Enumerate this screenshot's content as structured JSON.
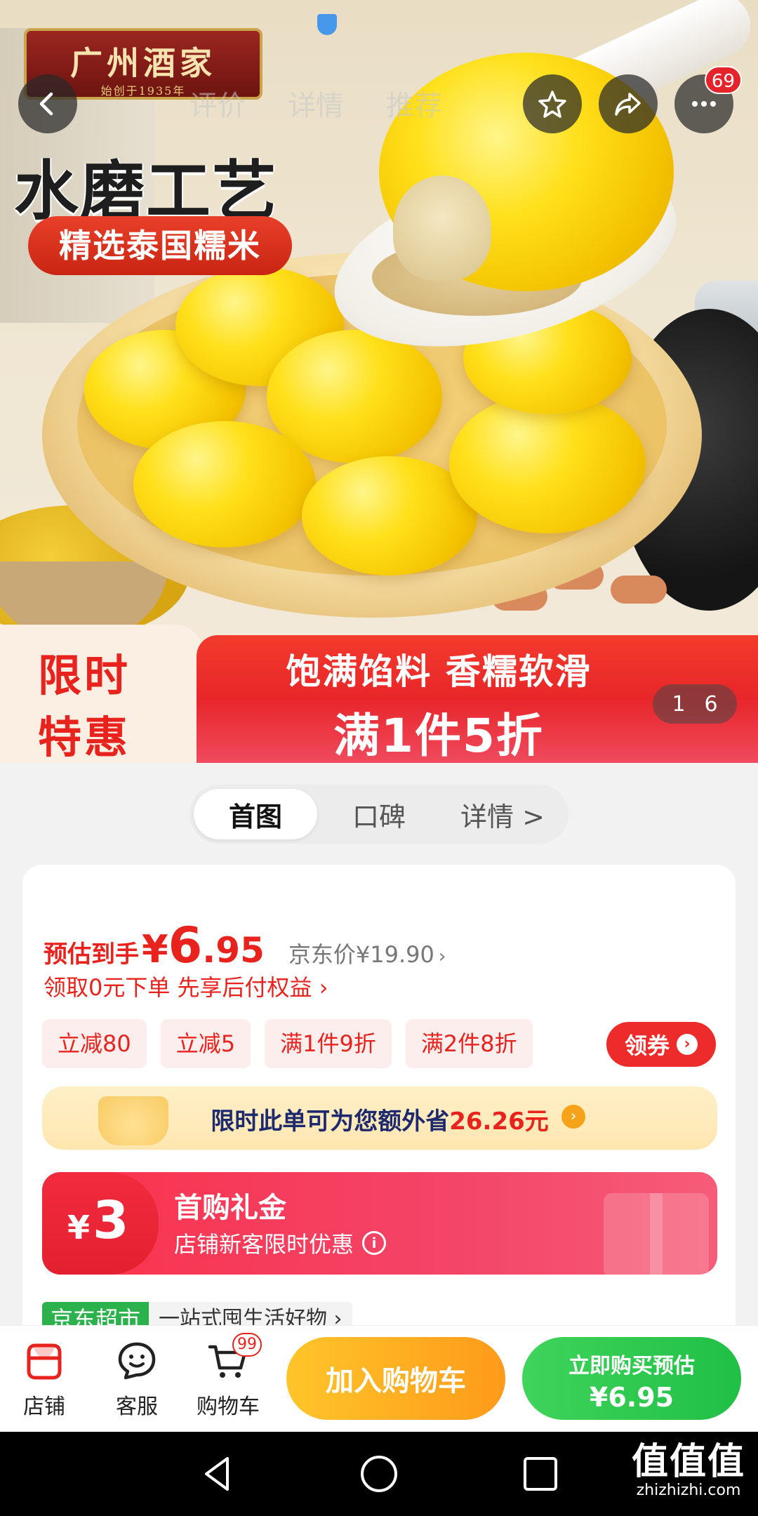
{
  "hero": {
    "brand_name": "广州酒家",
    "brand_since": "始创于1935年",
    "title": "水磨工艺",
    "pill": "精选泰国糯米",
    "faded_tabs": [
      "评价",
      "详情",
      "推荐"
    ],
    "promo_left_line1": "限时",
    "promo_left_line2": "特惠",
    "promo_right_line1": "饱满馅料 香糯软滑",
    "promo_right_line2": "满1件5折",
    "image_index": "1",
    "image_total": "6",
    "more_badge": "69"
  },
  "tabs": {
    "items": [
      "首图",
      "口碑",
      "详情 >"
    ],
    "active": "首图"
  },
  "price": {
    "label": "预估到手",
    "yen": "¥",
    "int": "6",
    "dec": ".95",
    "jd_price": "京东价¥19.90",
    "chevron": "›",
    "tip": "领取0元下单 先享后付权益 ›"
  },
  "chips": [
    "立减80",
    "立减5",
    "满1件9折",
    "满2件8折"
  ],
  "coupon_button": "领券",
  "save_bar": {
    "text": "限时此单可为您额外省",
    "amount": "26.26元"
  },
  "gift": {
    "yen": "¥",
    "amount": "3",
    "title": "首购礼金",
    "subtitle": "店铺新客限时优惠"
  },
  "jd_row": {
    "tag": "京东超市",
    "desc": "一站式囤生活好物 ›"
  },
  "action_bar": {
    "store": "店铺",
    "service": "客服",
    "cart": "购物车",
    "cart_badge": "99",
    "add_cart": "加入购物车",
    "buy_line1": "立即购买预估",
    "buy_line2": "¥6.95"
  },
  "watermark": {
    "big": "值值值",
    "small": "zhizhizhi.com"
  },
  "colors": {
    "accent_red": "#e8231e",
    "cart_orange": "#ffae22",
    "buy_green": "#2bc850"
  }
}
